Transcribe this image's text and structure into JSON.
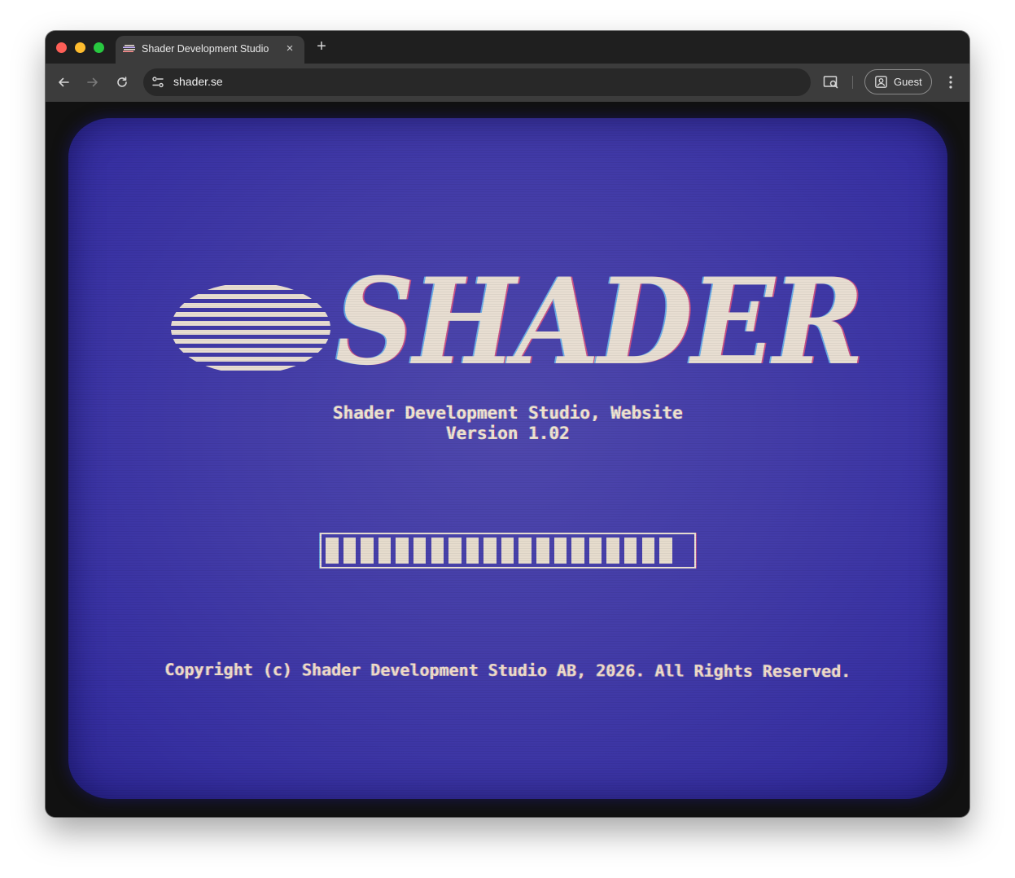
{
  "browser": {
    "tab_title": "Shader Development Studio",
    "tab_close_glyph": "×",
    "new_tab_glyph": "+",
    "url": "shader.se",
    "guest_label": "Guest"
  },
  "icons": {
    "back": "arrow-left-icon",
    "forward": "arrow-right-icon",
    "reload": "reload-icon",
    "site_info": "tune-icon",
    "cast": "cast-icon",
    "profile": "profile-icon",
    "menu": "kebab-menu-icon"
  },
  "page": {
    "logo_text": "SHADER",
    "subtitle_line1": "Shader Development Studio, Website",
    "subtitle_line2": "Version 1.02",
    "progress_segments": 20,
    "progress_fraction": 0.95,
    "copyright": "Copyright (c) Shader Development Studio AB, 2026. All Rights Reserved."
  },
  "colors": {
    "screen_blue": "#433ca8",
    "text_cream": "#e8ded2",
    "browser_dark": "#1f1f1f",
    "toolbar": "#3c3c3c"
  }
}
